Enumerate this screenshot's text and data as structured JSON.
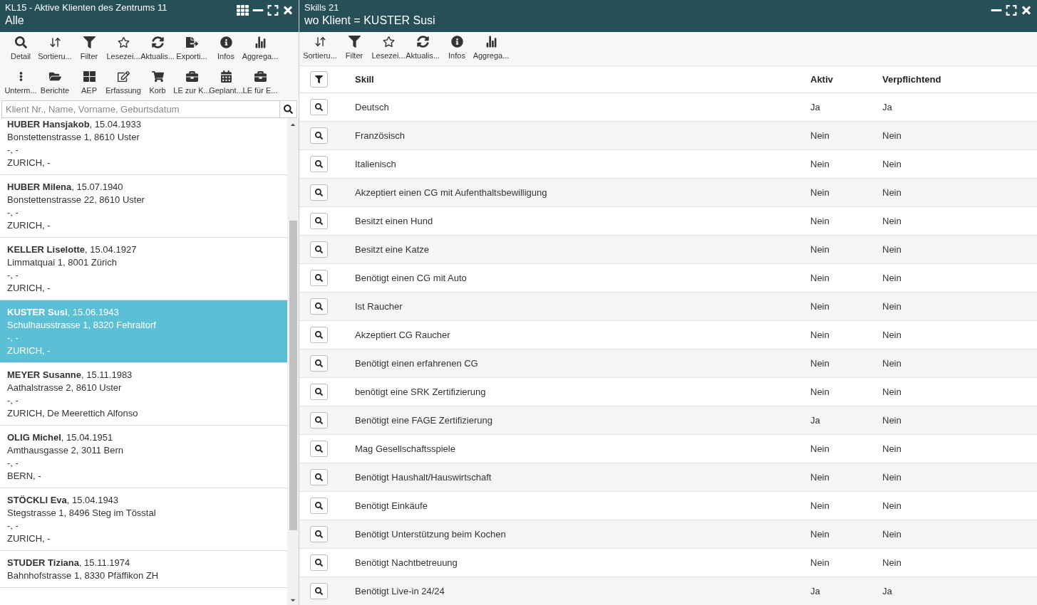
{
  "left_panel": {
    "title": "KL15 - Aktive Klienten des Zentrums 11",
    "subtitle": "Alle",
    "toolbar_rows": [
      [
        {
          "label": "Detail"
        },
        {
          "label": "Sortieru..."
        },
        {
          "label": "Filter"
        },
        {
          "label": "Lesezei..."
        },
        {
          "label": "Aktualis..."
        },
        {
          "label": "Exporti..."
        },
        {
          "label": "Infos"
        },
        {
          "label": "Aggrega..."
        }
      ],
      [
        {
          "label": "Unterm..."
        },
        {
          "label": "Berichte"
        },
        {
          "label": "AEP"
        },
        {
          "label": "Erfassung"
        },
        {
          "label": "Korb"
        },
        {
          "label": "LE zur K..."
        },
        {
          "label": "Geplant..."
        },
        {
          "label": "LE für E..."
        }
      ]
    ],
    "search": {
      "placeholder": "Klient Nr., Name, Vorname, Geburtsdatum"
    },
    "clients": [
      {
        "heading": "**HUBER Hansjakob**, 15.04.1933",
        "lines": [
          "Bonstettenstrasse 1, 8610 Uster",
          "-, -",
          "ZURICH, -"
        ],
        "selected": false
      },
      {
        "heading": "**HUBER Milena**, 15.07.1940",
        "lines": [
          "Bonstettenstrasse 22, 8610 Uster",
          "-, -",
          "ZURICH, -"
        ],
        "selected": false
      },
      {
        "heading": "**KELLER Liselotte**, 15.04.1927",
        "lines": [
          "Limmatquai 1, 8001 Zürich",
          "-, -",
          "ZURICH, -"
        ],
        "selected": false
      },
      {
        "heading": "**KUSTER Susi**, 15.06.1943",
        "lines": [
          "Schulhausstrasse 1, 8320 Fehraltorf",
          "-, -",
          "ZURICH, -"
        ],
        "selected": true
      },
      {
        "heading": "**MEYER Susanne**, 15.11.1983",
        "lines": [
          "Aathalstrasse 2, 8610 Uster",
          "-, -",
          "ZURICH, De Meerettich Alfonso"
        ],
        "selected": false
      },
      {
        "heading": "**OLIG Michel**, 15.04.1951",
        "lines": [
          "Amthausgasse 2, 3011 Bern",
          "-, -",
          "BERN, -"
        ],
        "selected": false
      },
      {
        "heading": "**STÖCKLI Eva**, 15.04.1943",
        "lines": [
          "Stegstrasse 1, 8496 Steg im Tösstal",
          "-, -",
          "ZURICH, -"
        ],
        "selected": false
      },
      {
        "heading": "**STUDER Tiziana**, 15.11.1974",
        "lines": [
          "Bahnhofstrasse 1, 8330 Pfäffikon ZH"
        ],
        "selected": false
      }
    ]
  },
  "right_panel": {
    "title": "Skills 21",
    "subtitle": "wo Klient = KUSTER Susi",
    "toolbar": [
      {
        "label": "Sortieru..."
      },
      {
        "label": "Filter"
      },
      {
        "label": "Lesezei..."
      },
      {
        "label": "Aktualis..."
      },
      {
        "label": "Infos"
      },
      {
        "label": "Aggrega..."
      }
    ],
    "table": {
      "columns": [
        "Skill",
        "Aktiv",
        "Verpflichtend"
      ],
      "rows": [
        [
          "Deutsch",
          "Ja",
          "Ja"
        ],
        [
          "Französisch",
          "Nein",
          "Nein"
        ],
        [
          "Italienisch",
          "Nein",
          "Nein"
        ],
        [
          "Akzeptiert einen CG mit Aufenthaltsbewilligung",
          "Nein",
          "Nein"
        ],
        [
          "Besitzt einen Hund",
          "Nein",
          "Nein"
        ],
        [
          "Besitzt eine Katze",
          "Nein",
          "Nein"
        ],
        [
          "Benötigt einen CG mit Auto",
          "Nein",
          "Nein"
        ],
        [
          "Ist Raucher",
          "Nein",
          "Nein"
        ],
        [
          "Akzeptiert CG Raucher",
          "Nein",
          "Nein"
        ],
        [
          "Benötigt einen erfahrenen CG",
          "Nein",
          "Nein"
        ],
        [
          "benötigt eine SRK Zertifizierung",
          "Nein",
          "Nein"
        ],
        [
          "Benötigt eine FAGE Zertifizierung",
          "Ja",
          "Nein"
        ],
        [
          "Mag Gesellschaftsspiele",
          "Nein",
          "Nein"
        ],
        [
          "Benötigt Haushalt/Hauswirtschaft",
          "Nein",
          "Nein"
        ],
        [
          "Benötigt Einkäufe",
          "Nein",
          "Nein"
        ],
        [
          "Benötigt Unterstützung beim Kochen",
          "Nein",
          "Nein"
        ],
        [
          "Benötigt Nachtbetreuung",
          "Nein",
          "Nein"
        ],
        [
          "Benötigt Live-in 24/24",
          "Ja",
          "Ja"
        ]
      ]
    }
  }
}
